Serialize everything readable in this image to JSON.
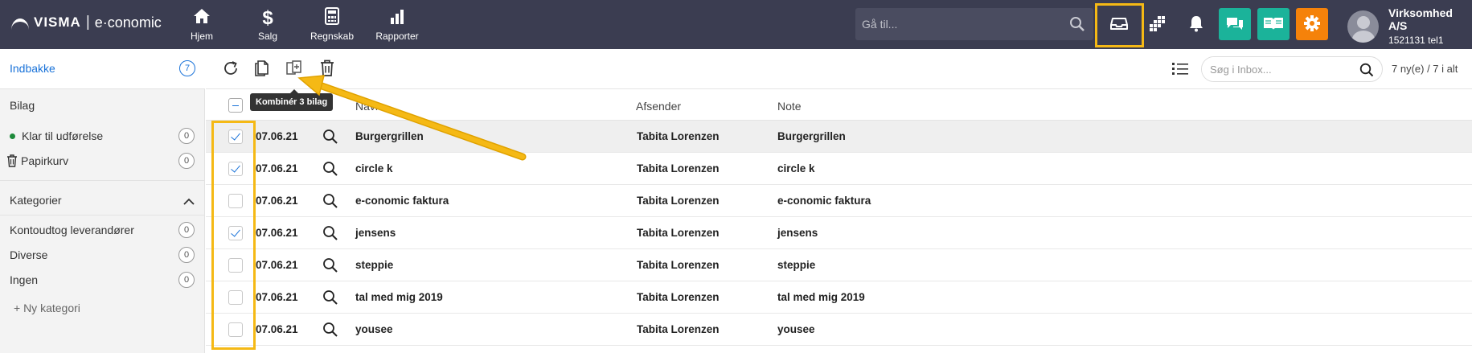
{
  "app": {
    "brand": "VISMA",
    "separator": "|",
    "product": "e·conomic"
  },
  "nav": [
    {
      "label": "Hjem",
      "icon": "home-icon"
    },
    {
      "label": "Salg",
      "icon": "dollar-icon"
    },
    {
      "label": "Regnskab",
      "icon": "calculator-icon"
    },
    {
      "label": "Rapporter",
      "icon": "bar-chart-icon"
    }
  ],
  "goto": {
    "placeholder": "Gå til..."
  },
  "user": {
    "name": "Virksomhed A/S",
    "id": "1521131 tel1"
  },
  "colors": {
    "topbar": "#3b3d51",
    "teal": "#1bb39a",
    "orange": "#f5820a",
    "highlight": "#f5b915",
    "link": "#1a73d9"
  },
  "sidebar": {
    "inbox": {
      "label": "Indbakke",
      "count": "7"
    },
    "bilag_header": "Bilag",
    "bilag": [
      {
        "label": "Klar til udførelse",
        "count": "0"
      },
      {
        "label": "Papirkurv",
        "count": "0"
      }
    ],
    "categories_header": "Kategorier",
    "categories": [
      {
        "label": "Kontoudtog leverandører",
        "count": "0"
      },
      {
        "label": "Diverse",
        "count": "0"
      },
      {
        "label": "Ingen",
        "count": "0"
      }
    ],
    "new_category": "+ Ny kategori"
  },
  "toolbar": {
    "tooltip": "Kombinér 3 bilag",
    "search_placeholder": "Søg i Inbox...",
    "count_text": "7 ny(e) / 7 i alt"
  },
  "table": {
    "headers": {
      "name": "Navn",
      "sender": "Afsender",
      "note": "Note"
    },
    "rows": [
      {
        "date": "07.06.21",
        "name": "Burgergrillen",
        "sender": "Tabita Lorenzen",
        "note": "Burgergrillen",
        "checked": true
      },
      {
        "date": "07.06.21",
        "name": "circle k",
        "sender": "Tabita Lorenzen",
        "note": "circle k",
        "checked": true
      },
      {
        "date": "07.06.21",
        "name": "e-conomic faktura",
        "sender": "Tabita Lorenzen",
        "note": "e-conomic faktura",
        "checked": false
      },
      {
        "date": "07.06.21",
        "name": "jensens",
        "sender": "Tabita Lorenzen",
        "note": "jensens",
        "checked": true
      },
      {
        "date": "07.06.21",
        "name": "steppie",
        "sender": "Tabita Lorenzen",
        "note": "steppie",
        "checked": false
      },
      {
        "date": "07.06.21",
        "name": "tal med mig 2019",
        "sender": "Tabita Lorenzen",
        "note": "tal med mig 2019",
        "checked": false
      },
      {
        "date": "07.06.21",
        "name": "yousee",
        "sender": "Tabita Lorenzen",
        "note": "yousee",
        "checked": false
      }
    ]
  }
}
